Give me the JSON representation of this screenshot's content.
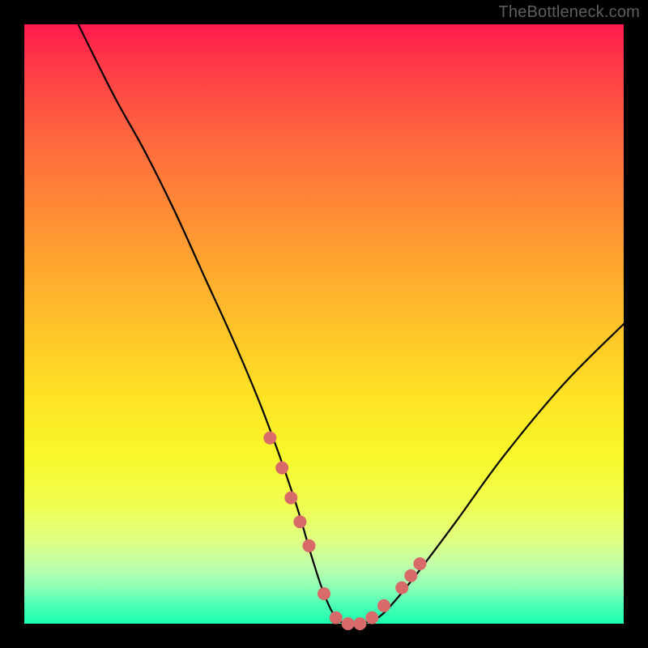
{
  "watermark": "TheBottleneck.com",
  "chart_data": {
    "type": "line",
    "title": "",
    "xlabel": "",
    "ylabel": "",
    "xlim": [
      0,
      100
    ],
    "ylim": [
      0,
      100
    ],
    "grid": false,
    "legend": false,
    "series": [
      {
        "name": "curve",
        "x": [
          9,
          15,
          20,
          25,
          30,
          35,
          40,
          45,
          48,
          50,
          52,
          54,
          56,
          59,
          62,
          66,
          72,
          80,
          90,
          100
        ],
        "values": [
          100,
          88,
          79,
          69,
          58,
          47,
          35,
          21,
          11,
          5,
          1,
          0,
          0,
          1,
          4,
          9,
          17,
          28,
          40,
          50
        ]
      }
    ],
    "markers": {
      "name": "highlight-dots",
      "x": [
        41,
        43,
        44.5,
        46,
        47.5,
        50,
        52,
        54,
        56,
        58,
        60,
        63,
        64.5,
        66
      ],
      "values": [
        31,
        26,
        21,
        17,
        13,
        5,
        1,
        0,
        0,
        1,
        3,
        6,
        8,
        10
      ],
      "color": "#d86a6a",
      "radius": 8
    },
    "gradient_stops": [
      {
        "pos": 0,
        "color": "#ff1a4d"
      },
      {
        "pos": 20,
        "color": "#ff6a3e"
      },
      {
        "pos": 50,
        "color": "#ffbc2b"
      },
      {
        "pos": 75,
        "color": "#f0ff4e"
      },
      {
        "pos": 100,
        "color": "#18ffae"
      }
    ]
  }
}
